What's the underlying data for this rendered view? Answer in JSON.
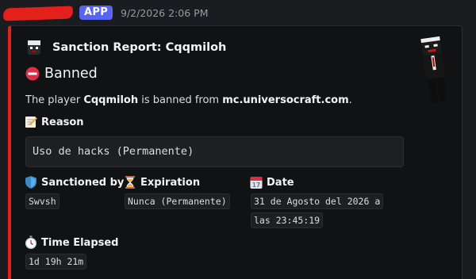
{
  "message": {
    "author_redacted": true,
    "badge": "APP",
    "timestamp": "9/2/2026 2:06 PM"
  },
  "embed": {
    "accent_color": "#e3201c",
    "author": "Sanction Report: Cqqmiloh",
    "title": "Banned",
    "description": {
      "prefix": "The player ",
      "player": "Cqqmiloh",
      "middle": " is banned from ",
      "server": "mc.universocraft.com",
      "suffix": "."
    },
    "reason": {
      "name": "Reason",
      "icon": "memo-icon",
      "value": "Uso de hacks (Permanente)"
    },
    "fields": [
      {
        "name": "Sanctioned by",
        "icon": "shield-icon",
        "value": "Swvsh"
      },
      {
        "name": "Expiration",
        "icon": "hourglass-icon",
        "value": "Nunca (Permanente)"
      },
      {
        "name": "Date",
        "icon": "calendar-icon",
        "value_line1": "31 de Agosto del 2026 a",
        "value_line2": "las 23:45:19"
      }
    ],
    "elapsed": {
      "name": "Time Elapsed",
      "icon": "stopwatch-icon",
      "value": "1d 19h 21m"
    }
  }
}
